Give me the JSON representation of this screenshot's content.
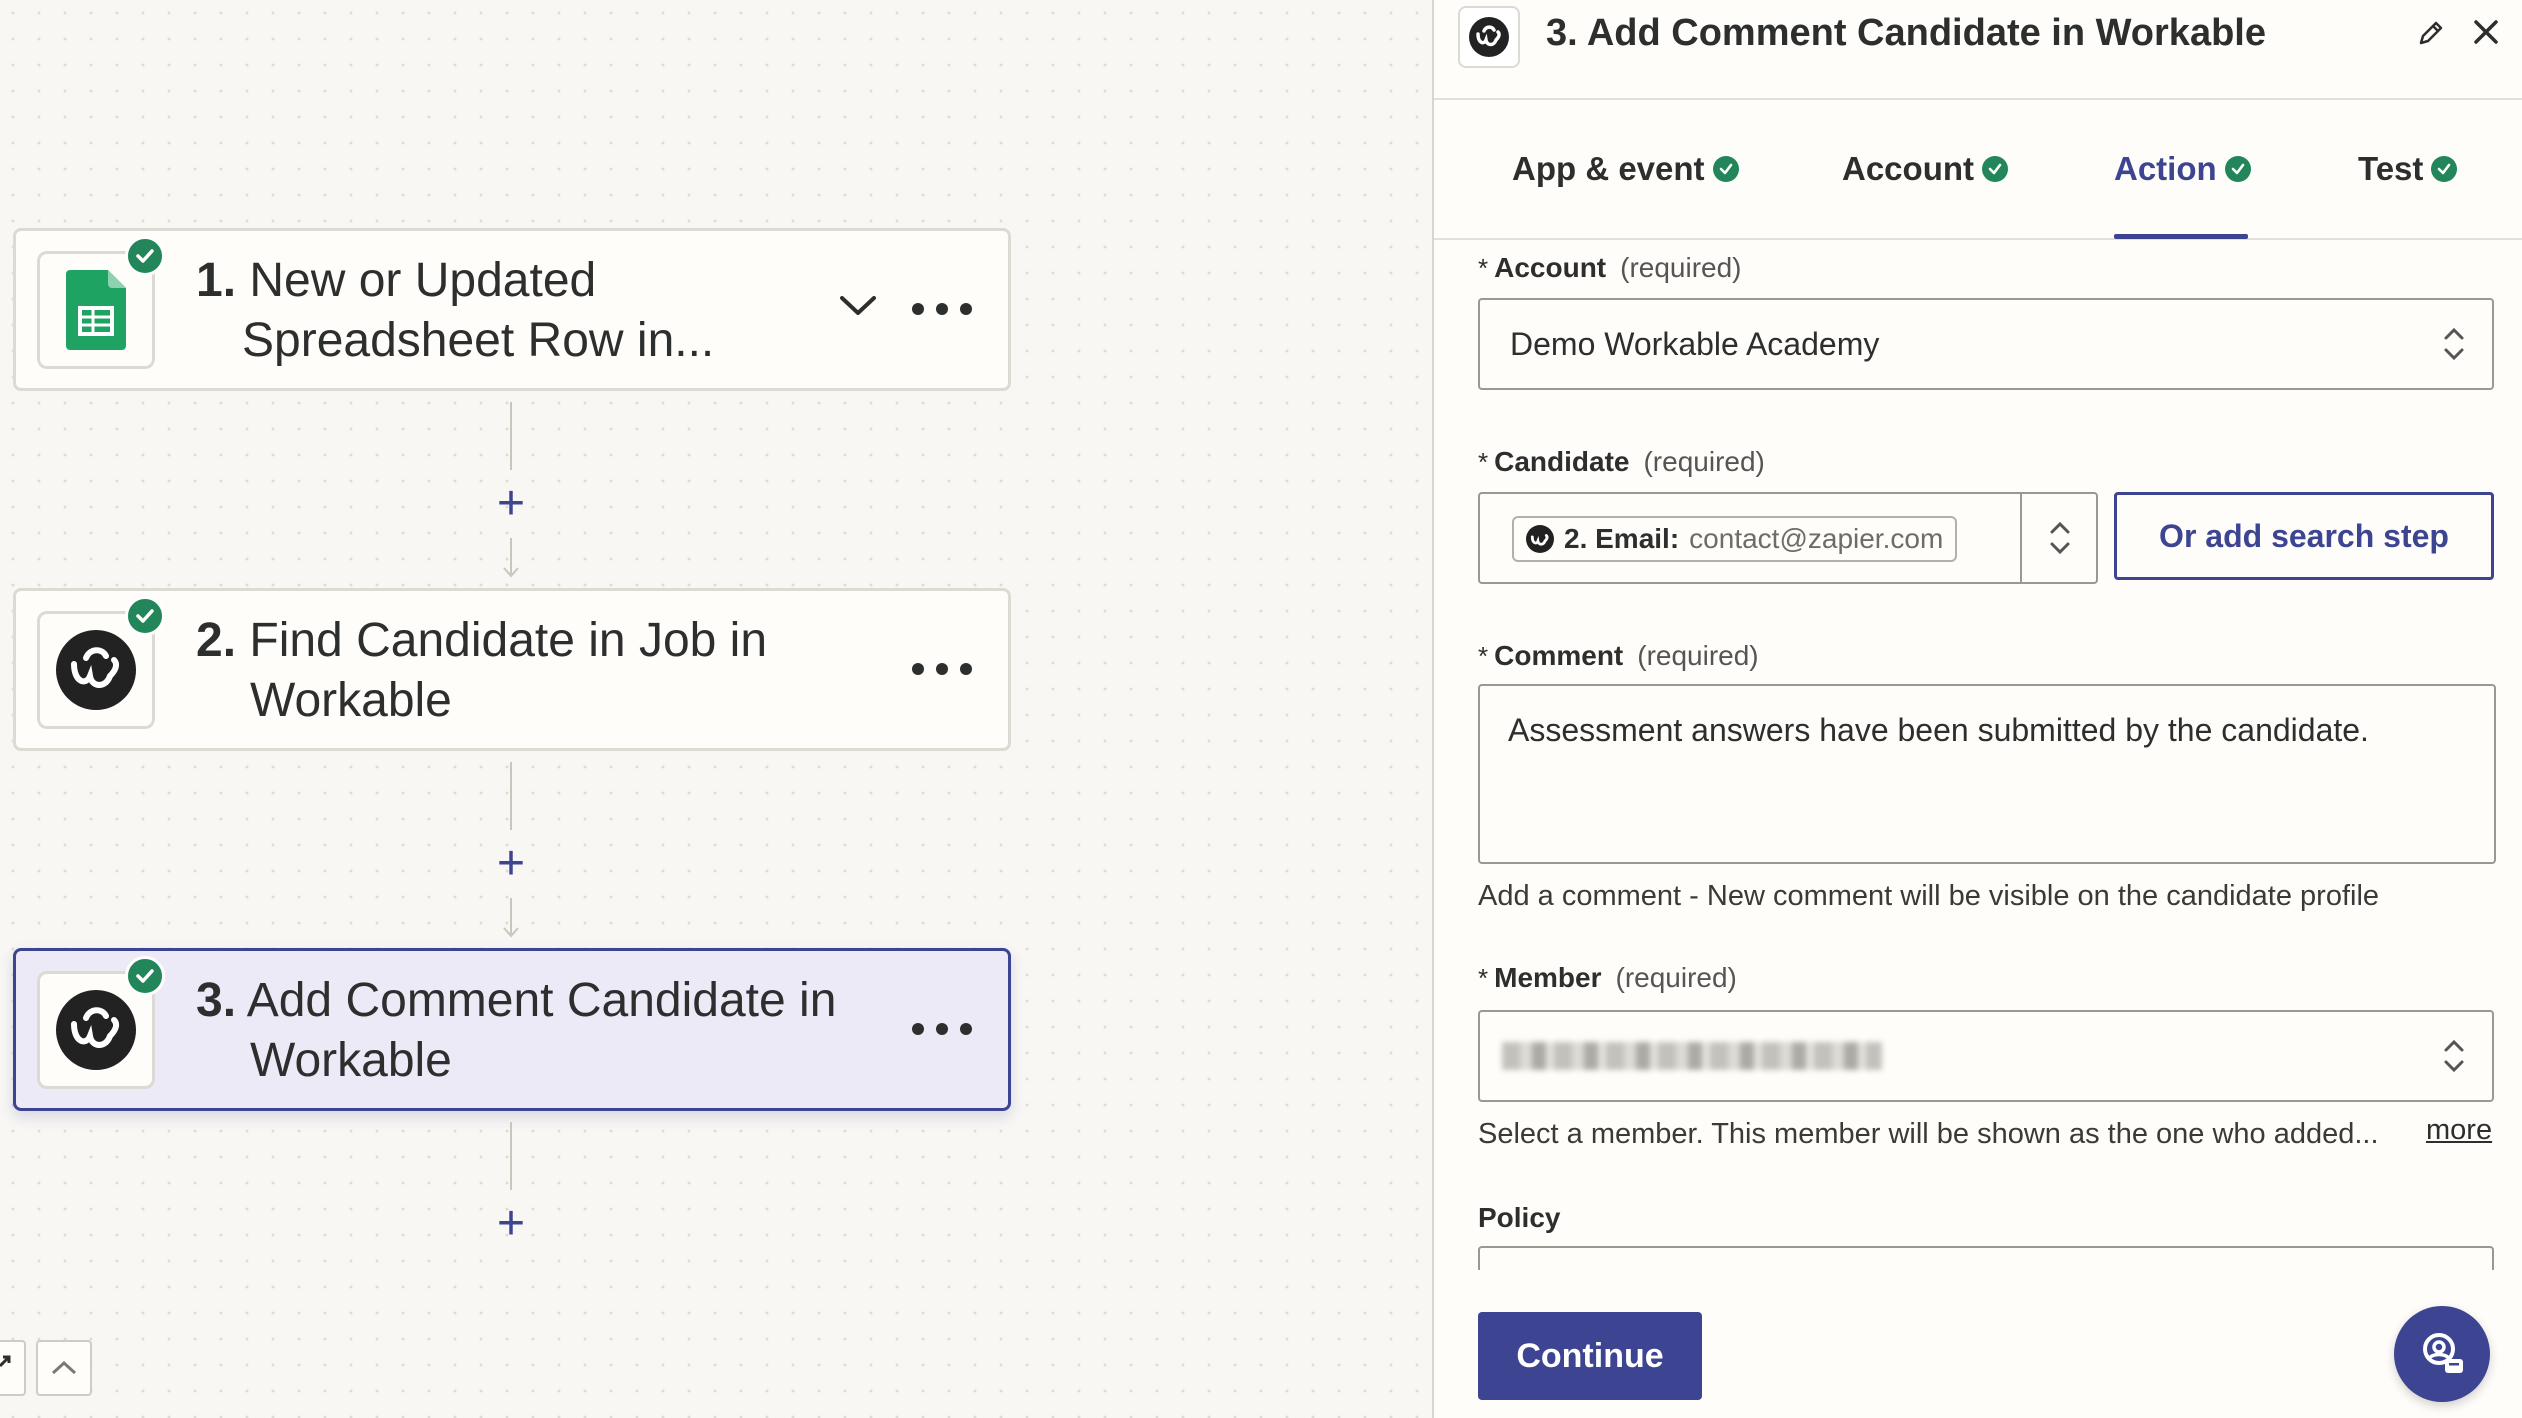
{
  "canvas": {
    "steps": [
      {
        "number": "1.",
        "title": "New or Updated Spreadsheet Row in...",
        "title_line1": "New or Updated",
        "title_line2": "Spreadsheet Row in...",
        "app_icon": "google-sheets-icon",
        "status": "complete"
      },
      {
        "number": "2.",
        "title_line1": "Find Candidate in Job in",
        "title_line2": "Workable",
        "app_icon": "workable-icon",
        "status": "complete"
      },
      {
        "number": "3.",
        "title_line1": "Add Comment Candidate in",
        "title_line2": "Workable",
        "app_icon": "workable-icon",
        "status": "complete",
        "selected": true
      }
    ],
    "add_step_symbol": "+",
    "controls": [
      "expand-icon",
      "chevron-up-icon"
    ]
  },
  "panel": {
    "title": "3. Add Comment Candidate in Workable",
    "tabs": [
      {
        "label": "App & event",
        "complete": true
      },
      {
        "label": "Account",
        "complete": true
      },
      {
        "label": "Action",
        "complete": true,
        "active": true
      },
      {
        "label": "Test",
        "complete": true
      }
    ],
    "required_marker": "*",
    "fields": {
      "account": {
        "label": "Account",
        "required_text": "(required)",
        "value": "Demo Workable Academy"
      },
      "candidate": {
        "label": "Candidate",
        "required_text": "(required)",
        "pill_label": "2. Email:",
        "pill_value": "contact@zapier.com",
        "search_step_button": "Or add search step"
      },
      "comment": {
        "label": "Comment",
        "required_text": "(required)",
        "value": "Assessment answers have been submitted by the candidate.",
        "help": "Add a comment - New comment will be visible on the candidate profile"
      },
      "member": {
        "label": "Member",
        "required_text": "(required)",
        "help": "Select a member. This member will be shown as the one who added...",
        "more_link": "more"
      },
      "policy": {
        "label": "Policy"
      }
    },
    "continue_button": "Continue"
  },
  "colors": {
    "accent": "#3d4592",
    "success": "#22865a",
    "sheets_green": "#1ea362",
    "workable_dark": "#222222"
  }
}
